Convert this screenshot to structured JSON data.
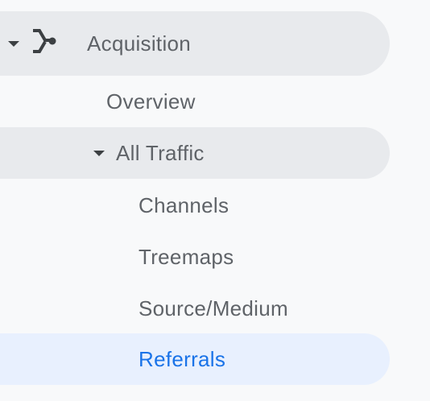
{
  "nav": {
    "acquisition": {
      "label": "Acquisition",
      "icon": "acquisition-fork-icon",
      "expanded": true
    },
    "overview": {
      "label": "Overview"
    },
    "all_traffic": {
      "label": "All Traffic",
      "expanded": true
    },
    "items": [
      {
        "label": "Channels"
      },
      {
        "label": "Treemaps"
      },
      {
        "label": "Source/Medium"
      },
      {
        "label": "Referrals",
        "selected": true
      }
    ]
  },
  "colors": {
    "background": "#f8f9fa",
    "hover_grey": "#e8eaed",
    "selected_bg": "#e8f0fe",
    "selected_text": "#1a73e8",
    "text": "#5f6368",
    "icon": "#3c4043"
  }
}
